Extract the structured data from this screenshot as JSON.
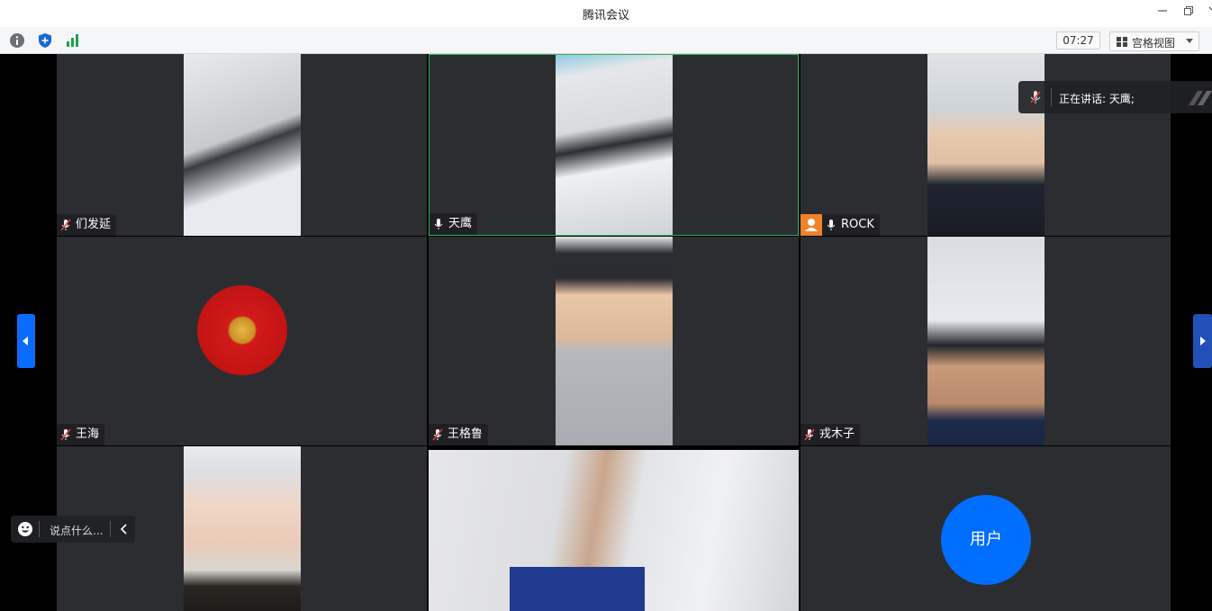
{
  "window": {
    "title": "腾讯会议"
  },
  "toolbar": {
    "timer": "07:27",
    "view_label": "宫格视图"
  },
  "speaking": {
    "text": "正在讲话: 天鹰;"
  },
  "chat": {
    "placeholder": "说点什么..."
  },
  "participants": [
    {
      "name": "们发延",
      "mic": "muted"
    },
    {
      "name": "天鹰",
      "mic": "on",
      "active": true
    },
    {
      "name": "ROCK",
      "mic": "on",
      "host": true
    },
    {
      "name": "王海",
      "mic": "muted"
    },
    {
      "name": "王格鲁",
      "mic": "muted"
    },
    {
      "name": "戎木子",
      "mic": "muted"
    },
    {
      "name": "",
      "mic": ""
    },
    {
      "name": "",
      "mic": ""
    },
    {
      "name": "",
      "mic": "",
      "avatar_text": "用户"
    }
  ],
  "colors": {
    "accent": "#006eff",
    "active_border": "#2fb35a",
    "tile_bg": "#2b2d31"
  }
}
